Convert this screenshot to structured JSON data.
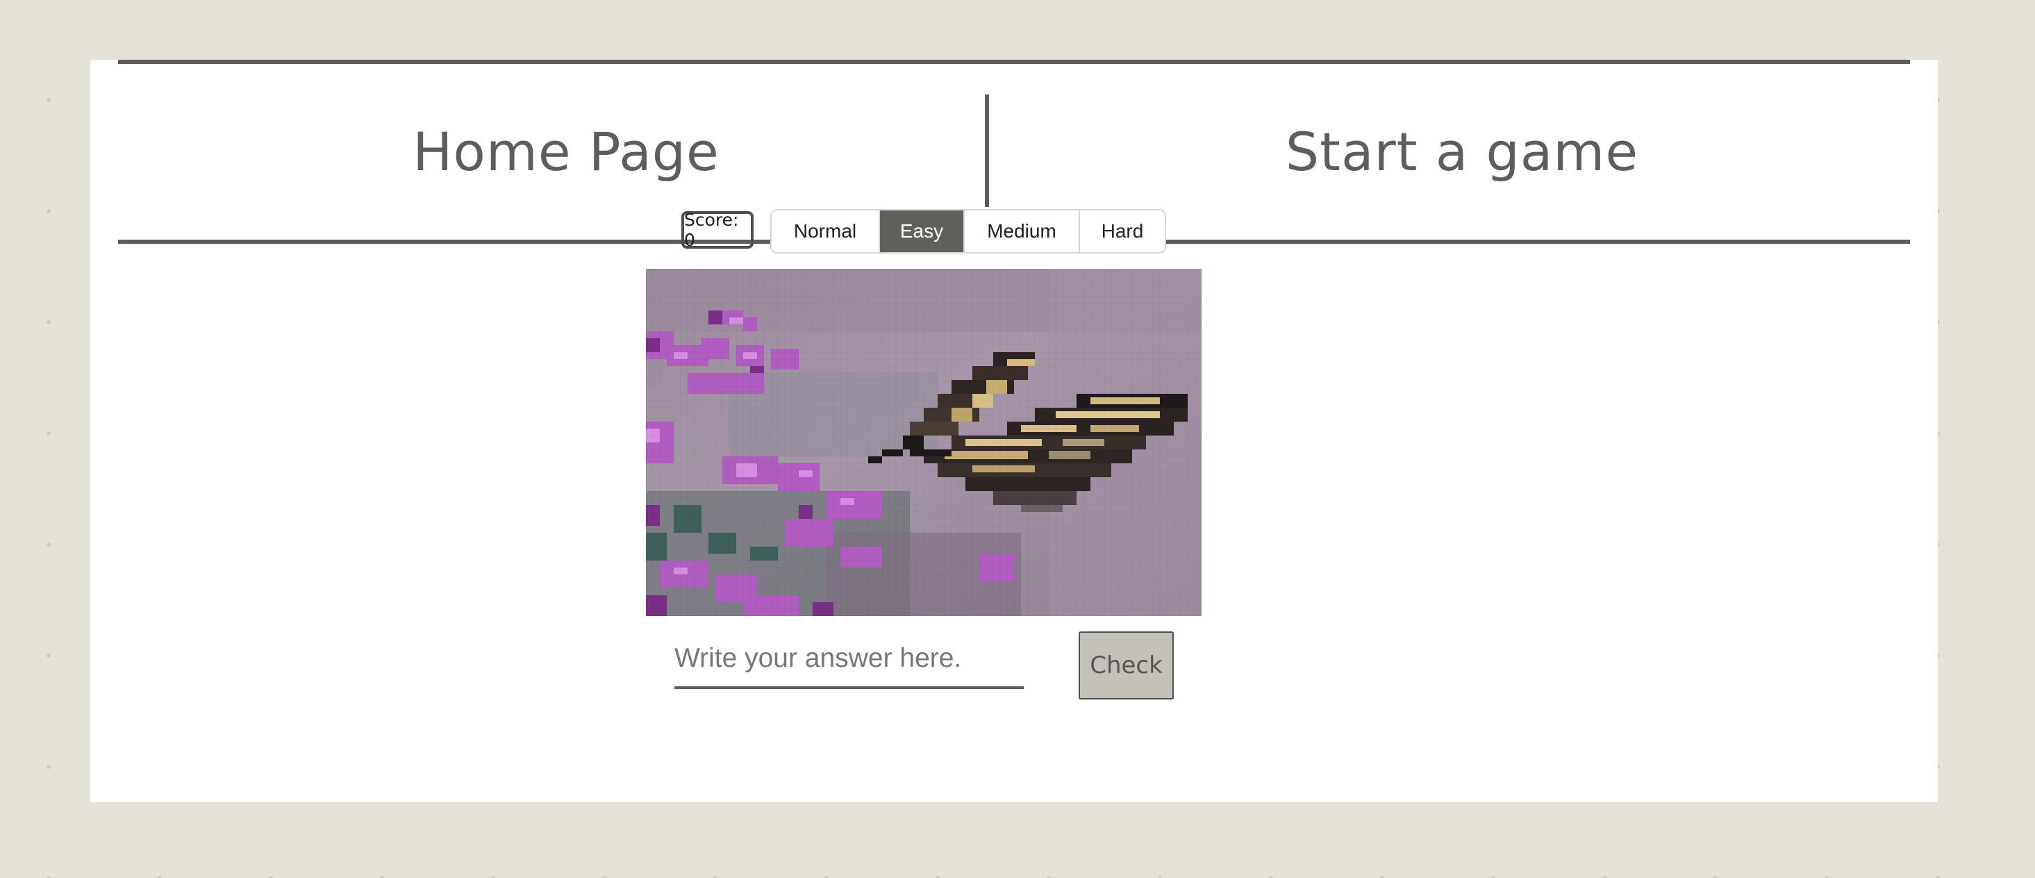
{
  "nav": {
    "home_label": "Home Page",
    "start_label": "Start a game"
  },
  "game": {
    "score_text": "Score: 0",
    "levels": [
      {
        "label": "Normal",
        "active": false
      },
      {
        "label": "Easy",
        "active": true
      },
      {
        "label": "Medium",
        "active": false
      },
      {
        "label": "Hard",
        "active": false
      }
    ],
    "answer_placeholder": "Write your answer here.",
    "answer_value": "",
    "check_label": "Check"
  },
  "colors": {
    "background": "#e4e2d7",
    "ink": "#5d5d5b",
    "active_level": "#5f605b",
    "check_button": "#c3c1b7"
  }
}
